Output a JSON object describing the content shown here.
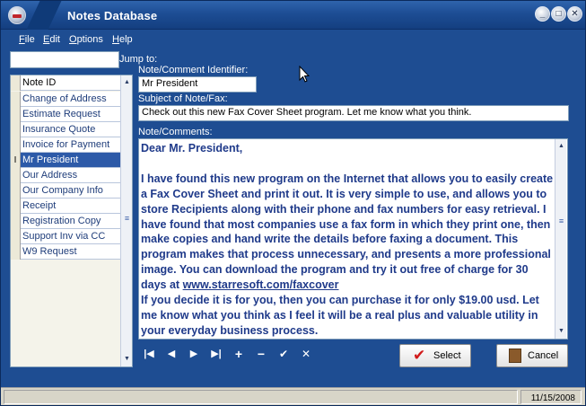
{
  "window": {
    "title": "Notes Database"
  },
  "menu": [
    {
      "label_u": "F",
      "label_rest": "ile"
    },
    {
      "label_u": "E",
      "label_rest": "dit"
    },
    {
      "label_u": "O",
      "label_rest": "ptions"
    },
    {
      "label_u": "H",
      "label_rest": "elp"
    }
  ],
  "search": {
    "label": "Jump to:",
    "value": ""
  },
  "list": {
    "header": "Note ID",
    "items": [
      "Change of Address",
      "Estimate Request",
      "Insurance Quote",
      "Invoice for Payment",
      "Mr President",
      "Our Address",
      "Our Company Info",
      "Receipt",
      "Registration Copy",
      "Support Inv via CC",
      "W9 Request"
    ],
    "selected_index": 4
  },
  "form": {
    "identifier_label": "Note/Comment Identifier:",
    "identifier_value": "Mr President",
    "subject_label": "Subject of Note/Fax:",
    "subject_value": "Check out this new Fax Cover Sheet program.  Let me know what you think.",
    "notes_label": "Note/Comments:",
    "notes_para1": "Dear Mr. President,",
    "notes_para2": "I have found this new program on the Internet that allows you to easily create a Fax Cover Sheet and print it out.  It is very simple to use, and allows you to store Recipients along with their phone and fax numbers for easy retrieval.  I have found that most companies use a fax form in which they print one, then make copies and hand write the details before faxing a document.  This program makes that process unnecessary, and presents a more professional image.  You can download the program and try it out free of charge for 30 days at",
    "notes_link": "www.starresoft.com/faxcover",
    "notes_para3": "If you decide it is for you, then you can purchase it for only $19.00 usd.  Let me know what you think as I feel it will be a real plus and valuable utility in your everyday business process."
  },
  "navigator": {
    "first": "|◀",
    "prior": "◀",
    "next": "▶",
    "last": "▶|",
    "insert": "+",
    "delete": "−",
    "post": "✔",
    "cancel": "✕"
  },
  "buttons": {
    "select": "Select",
    "cancel": "Cancel"
  },
  "status": {
    "date": "11/15/2008"
  },
  "colors": {
    "selected": "#2d5aa8",
    "notes_text": "#1f3a8a",
    "window_bg": "#1e4d92"
  }
}
